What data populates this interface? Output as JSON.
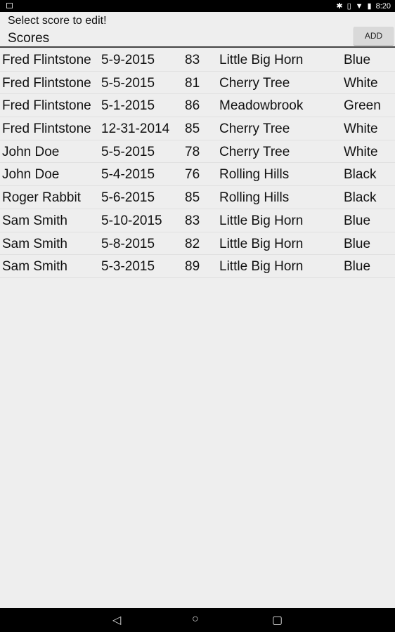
{
  "status": {
    "time": "8:20",
    "icons": [
      "image-icon",
      "bluetooth-icon",
      "vibrate-icon",
      "wifi-icon",
      "battery-icon"
    ]
  },
  "header": {
    "subtitle": "Select score to edit!",
    "title": "Scores",
    "add_label": "ADD"
  },
  "rows": [
    [
      "Fred Flintstone",
      "5-9-2015",
      "83",
      "Little Big Horn",
      "Blue"
    ],
    [
      "Fred Flintstone",
      "5-5-2015",
      "81",
      "Cherry Tree",
      "White"
    ],
    [
      "Fred Flintstone",
      "5-1-2015",
      "86",
      "Meadowbrook",
      "Green"
    ],
    [
      "Fred Flintstone",
      "12-31-2014",
      "85",
      "Cherry Tree",
      "White"
    ],
    [
      "John Doe",
      "5-5-2015",
      "78",
      "Cherry Tree",
      "White"
    ],
    [
      "John Doe",
      "5-4-2015",
      "76",
      "Rolling Hills",
      "Black"
    ],
    [
      "Roger Rabbit",
      "5-6-2015",
      "85",
      "Rolling Hills",
      "Black"
    ],
    [
      "Sam Smith",
      "5-10-2015",
      "83",
      "Little Big Horn",
      "Blue"
    ],
    [
      "Sam Smith",
      "5-8-2015",
      "82",
      "Little Big Horn",
      "Blue"
    ],
    [
      "Sam Smith",
      "5-3-2015",
      "89",
      "Little Big Horn",
      "Blue"
    ]
  ],
  "nav": {
    "icons": [
      "back-icon",
      "home-icon",
      "recents-icon"
    ]
  }
}
